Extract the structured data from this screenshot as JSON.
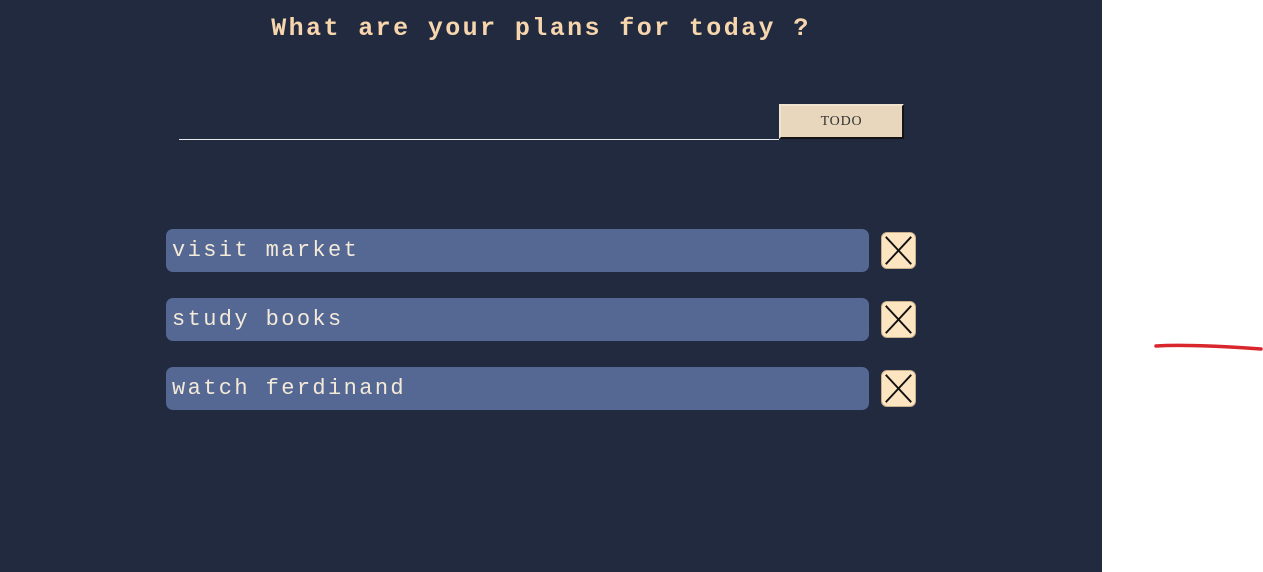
{
  "header": {
    "title": "What are your plans for today ?"
  },
  "form": {
    "input_value": "",
    "input_placeholder": "",
    "submit_label": "TODO"
  },
  "todos": [
    {
      "text": "visit market",
      "delete_icon": "close-icon"
    },
    {
      "text": "study books",
      "delete_icon": "close-icon"
    },
    {
      "text": "watch ferdinand",
      "delete_icon": "close-icon"
    }
  ],
  "colors": {
    "background": "#222a40",
    "title": "#f7d6ae",
    "todo_item": "#546893",
    "delete_button": "#fde5c1",
    "submit_button": "#e8d7bd",
    "outside_area": "#ffffff",
    "stray_mark": "#d9262c"
  }
}
